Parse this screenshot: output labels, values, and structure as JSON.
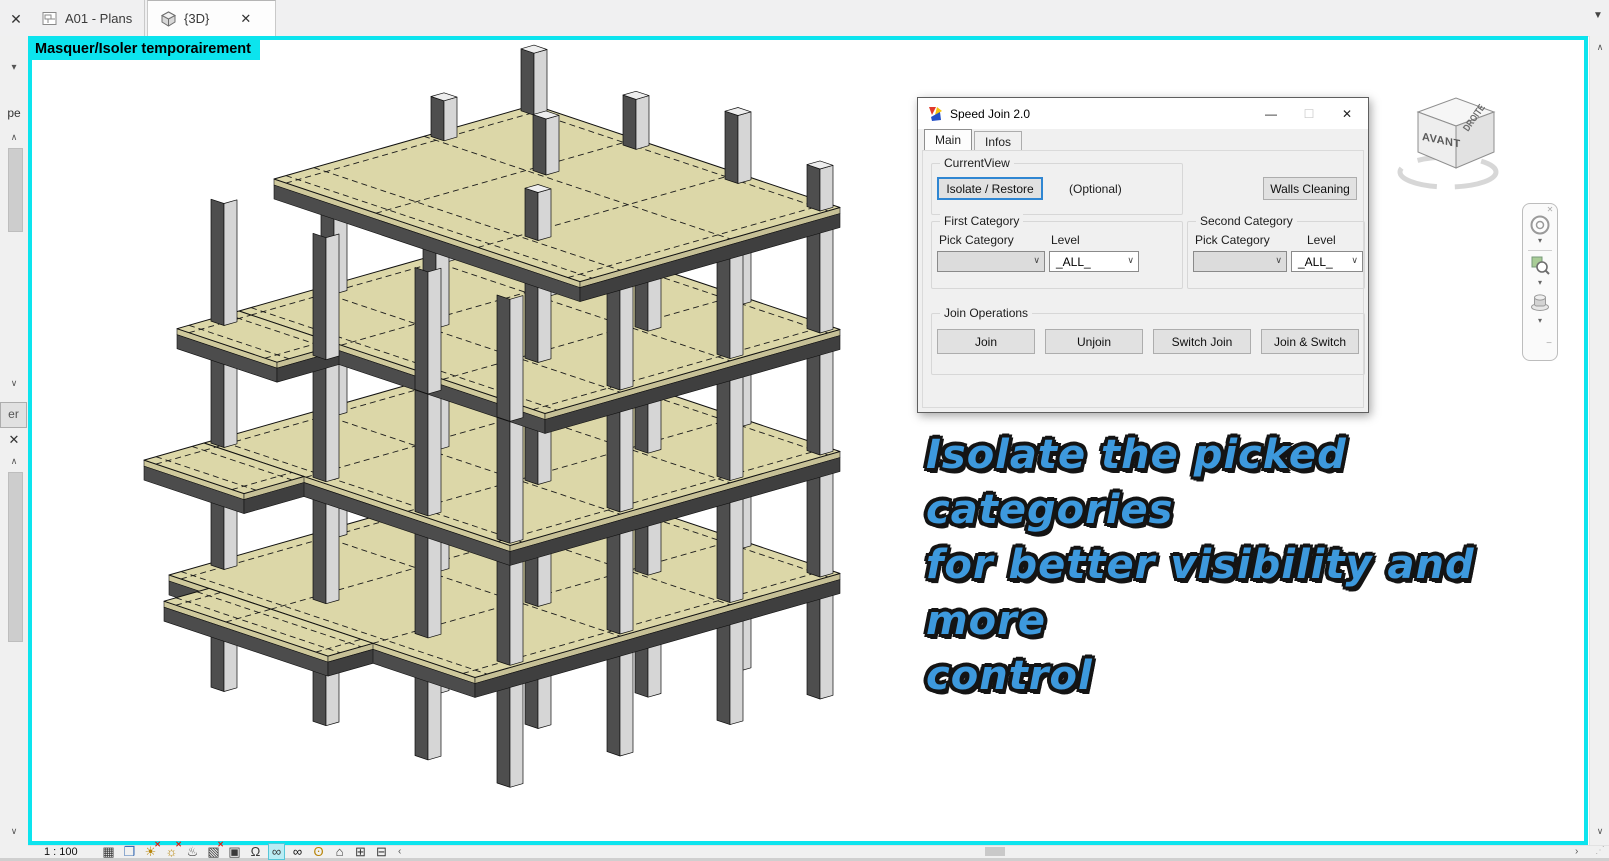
{
  "tab_bar": {
    "close_glyph": "✕",
    "tab_list_glyph": "▼",
    "tabs": [
      {
        "label": "A01 - Plans"
      },
      {
        "label": "{3D}",
        "close_glyph": "✕"
      }
    ]
  },
  "viewport": {
    "mode_label": "Masquer/Isoler temporairement",
    "accent_color": "#0ce4ee"
  },
  "left_panel": {
    "truncated_type_text": "pe",
    "truncated_button_text": "er",
    "close_glyph": "✕",
    "caret_down": "▾",
    "scroll_up": "∧",
    "scroll_down": "∨"
  },
  "dialog": {
    "title": "Speed Join 2.0",
    "window_buttons": {
      "minimize": "—",
      "maximize": "☐",
      "close": "✕"
    },
    "tabs": [
      {
        "label": "Main"
      },
      {
        "label": "Infos"
      }
    ],
    "current_view": {
      "label": "CurrentView",
      "isolate_button": "Isolate / Restore",
      "optional_label": "(Optional)"
    },
    "walls_button": "Walls Cleaning",
    "first_category": {
      "label": "First Category",
      "pick_label": "Pick Category",
      "level_label": "Level",
      "pick_value": "",
      "level_value": "_ALL_"
    },
    "second_category": {
      "label": "Second Category",
      "pick_label": "Pick Category",
      "level_label": "Level",
      "pick_value": "",
      "level_value": "_ALL_"
    },
    "join_operations": {
      "label": "Join Operations",
      "buttons": [
        "Join",
        "Unjoin",
        "Switch Join",
        "Join & Switch"
      ]
    },
    "combo_glyph": "∨"
  },
  "caption": {
    "color": "#3d99dd",
    "lines": [
      "Isolate the picked categories",
      "for better visibility and more",
      "control"
    ]
  },
  "viewcube": {
    "front_label": "AVANT",
    "right_label": "DROITE"
  },
  "nav_bar": {
    "close_glyph": "✕",
    "expand_glyph": "▾",
    "collapse_glyph": "−"
  },
  "view_control_bar": {
    "scale_label": "1 : 100",
    "off_marker": "✕",
    "icons": [
      {
        "name": "detail-level",
        "glyph": "▦"
      },
      {
        "name": "visual-style",
        "glyph": "❒"
      },
      {
        "name": "sun-path-off",
        "glyph": "☀",
        "off": true
      },
      {
        "name": "shadows-off",
        "glyph": "☼",
        "off": true
      },
      {
        "name": "rendering-dialog",
        "glyph": "♨"
      },
      {
        "name": "crop-view-off",
        "glyph": "▧",
        "off": true
      },
      {
        "name": "crop-region",
        "glyph": "▣"
      },
      {
        "name": "unlocked-3d-view",
        "glyph": "Ω"
      },
      {
        "name": "temporary-hide-isolate",
        "glyph": "∞",
        "active": true
      },
      {
        "name": "reveal-hidden-elements",
        "glyph": "∞"
      },
      {
        "name": "temporary-view-properties",
        "glyph": "ʘ"
      },
      {
        "name": "analytical-model",
        "glyph": "⌂"
      },
      {
        "name": "displacement-sets",
        "glyph": "⊞"
      },
      {
        "name": "reveal-constraints",
        "glyph": "⊟"
      }
    ]
  },
  "scrollbars": {
    "up": "∧",
    "down": "∨",
    "left": "‹",
    "right": "›",
    "grip": "⋰"
  }
}
